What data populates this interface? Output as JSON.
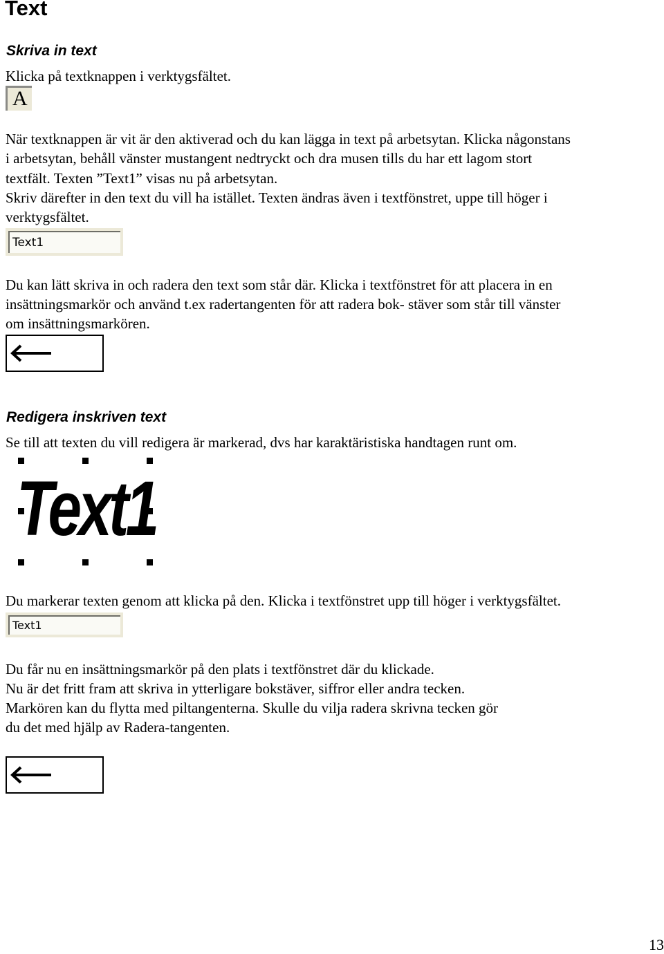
{
  "title": "Text",
  "sections": [
    {
      "heading": "Skriva in text",
      "intro": "Klicka på textknappen i verktygsfältet.",
      "tool_button_glyph": "A",
      "paragraph1": [
        "När textknappen är vit är den aktiverad och du kan lägga in text på arbetsytan. Klicka någonstans",
        "i arbetsytan, behåll vänster mustangent nedtryckt och dra musen tills du har ett lagom stort",
        "textfält. Texten ”Text1” visas nu på arbetsytan.",
        "Skriv därefter in den text du vill ha istället. Texten ändras även i textfönstret, uppe till höger i",
        "verktygsfältet."
      ],
      "text_field_value": "Text1",
      "paragraph2": [
        "Du kan lätt skriva in och radera den text som står där. Klicka i textfönstret för att  placera in en",
        "insättningsmarkör och använd t.ex radertangenten för att radera bok- stäver som står till vänster",
        "om insättningsmarkören."
      ],
      "key_icon": "backspace-arrow"
    },
    {
      "heading": "Redigera inskriven text",
      "intro": "Se till att texten du vill redigera är markerad, dvs har karaktäristiska handtagen runt om.",
      "selected_text_object": "Text1",
      "paragraph1": "Du markerar texten genom att klicka på den.  Klicka i textfönstret upp till höger i verktygsfältet.",
      "text_field_value": "Text1",
      "paragraph2": [
        "Du får nu en insättningsmarkör på den plats i textfönstret där du klickade.",
        "Nu är det fritt fram att skriva in ytterligare bokstäver, siffror eller andra tecken.",
        "Markören kan du flytta med piltangenterna. Skulle du vilja radera skrivna tecken gör",
        "du det med hjälp av Radera-tangenten."
      ],
      "key_icon": "backspace-arrow"
    }
  ],
  "page_number": "13"
}
